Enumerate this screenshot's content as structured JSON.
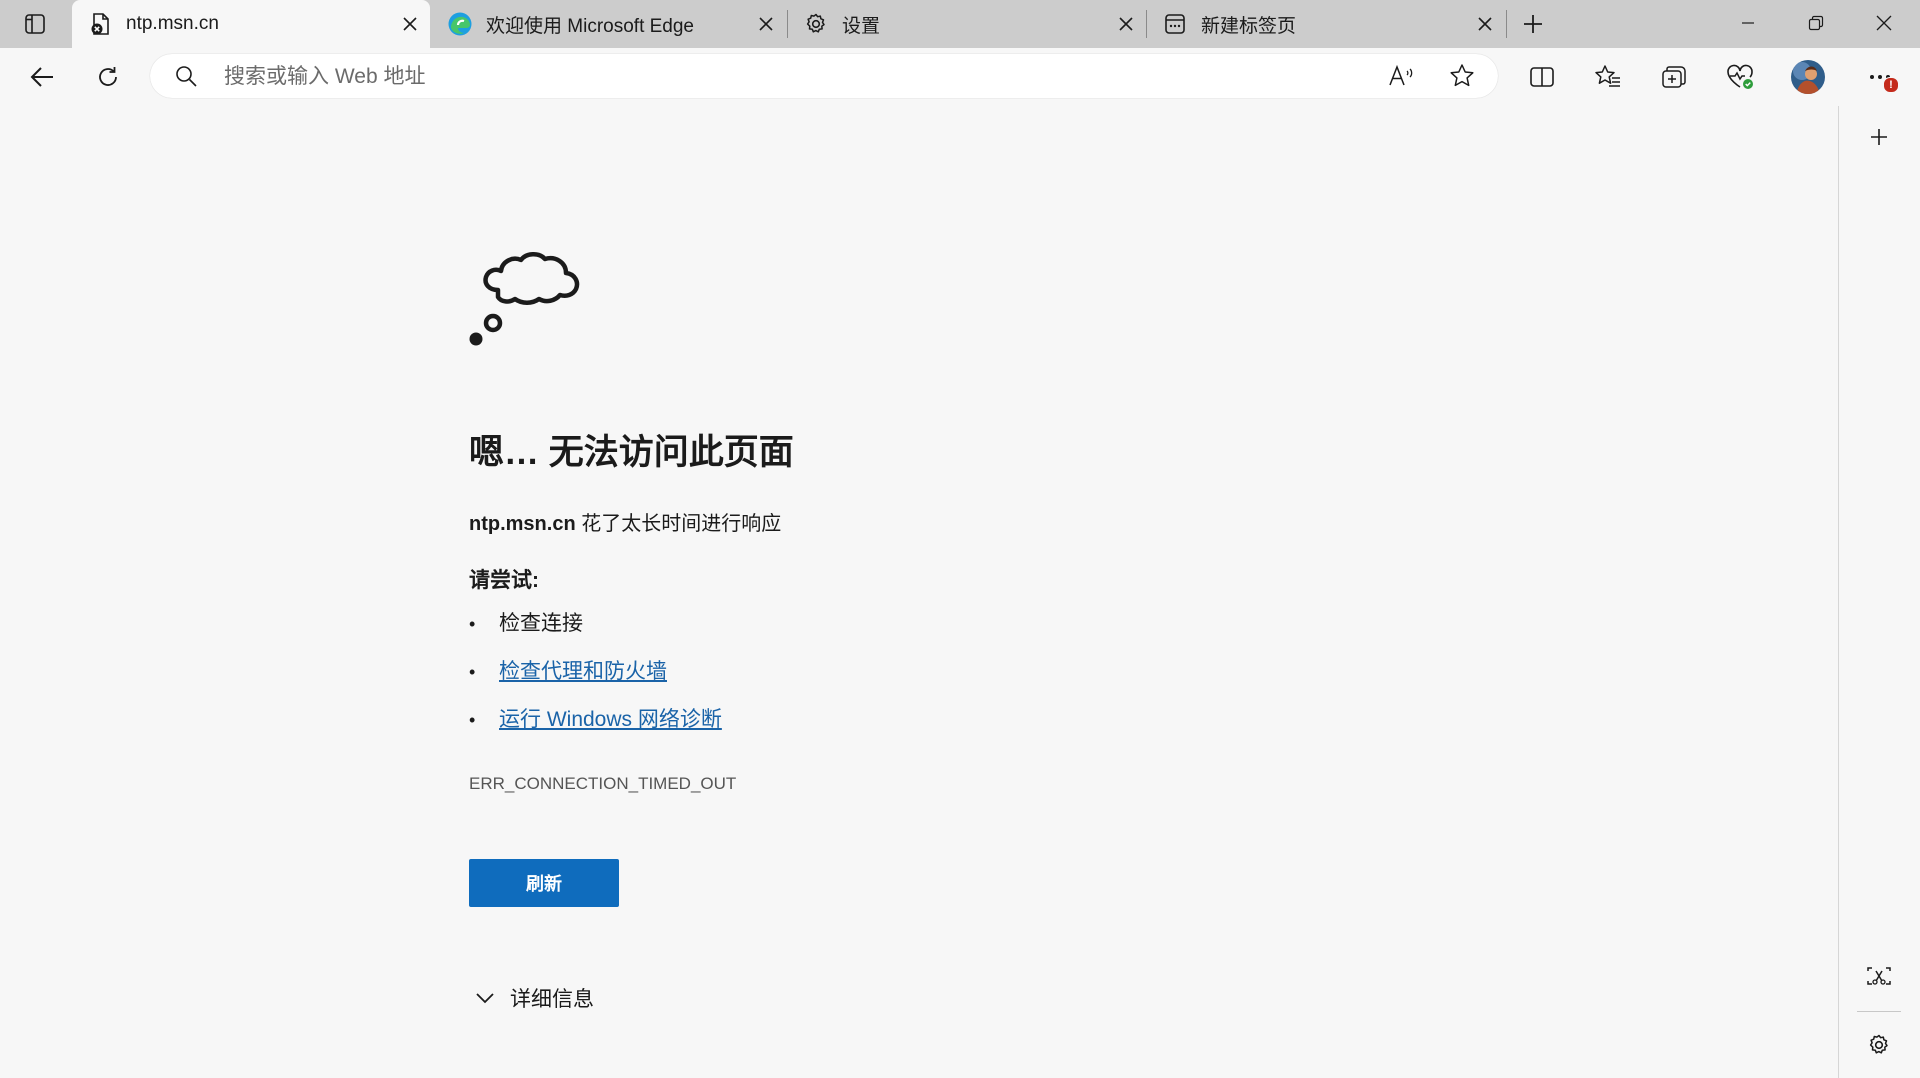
{
  "tabs": [
    {
      "title": "ntp.msn.cn",
      "favicon": "error-page-icon",
      "active": true
    },
    {
      "title": "欢迎使用 Microsoft Edge",
      "favicon": "edge-logo-icon",
      "active": false
    },
    {
      "title": "设置",
      "favicon": "gear-icon",
      "active": false
    },
    {
      "title": "新建标签页",
      "favicon": "new-tab-page-icon",
      "active": false
    }
  ],
  "address_bar": {
    "placeholder": "搜索或输入 Web 地址",
    "value": ""
  },
  "toolbar_icons": [
    "back-arrow-icon",
    "refresh-icon",
    "read-aloud-icon",
    "favorite-star-icon",
    "split-screen-icon",
    "favorites-icon",
    "collections-icon",
    "browser-essentials-icon",
    "profile-avatar",
    "more-options-icon"
  ],
  "notification_badge": "!",
  "error_page": {
    "heading": "嗯… 无法访问此页面",
    "host": "ntp.msn.cn",
    "message": " 花了太长时间进行响应",
    "try_label": "请尝试:",
    "suggestions": [
      {
        "text": "检查连接",
        "link": false
      },
      {
        "text": "检查代理和防火墙",
        "link": true
      },
      {
        "text": "运行 Windows 网络诊断",
        "link": true
      }
    ],
    "error_code": "ERR_CONNECTION_TIMED_OUT",
    "refresh_button": "刷新",
    "details_label": "详细信息"
  },
  "colors": {
    "tab_strip": "#cccccc",
    "page_background": "#f7f7f7",
    "accent_button": "#0f6cbd",
    "link": "#1a63a8",
    "badge": "#c42b1c"
  }
}
